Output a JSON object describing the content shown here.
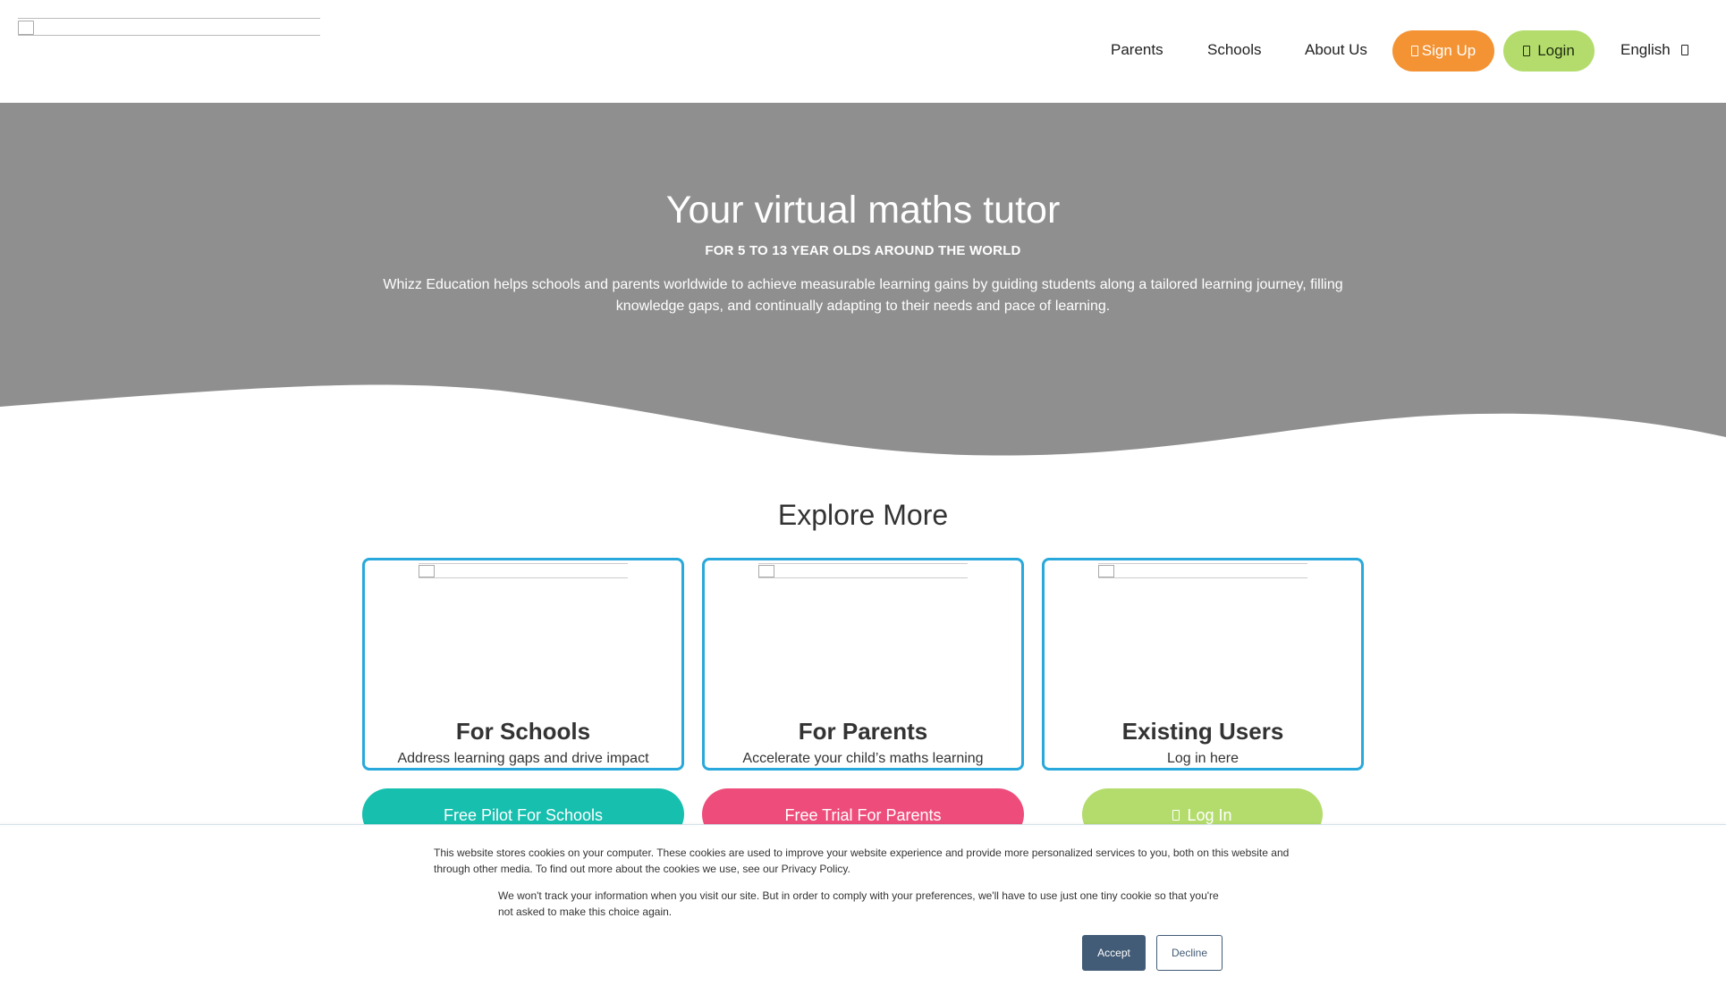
{
  "header": {
    "nav": [
      "Parents",
      "Schools",
      "About Us"
    ],
    "signup_label": "Sign Up",
    "login_label": "Login",
    "language": "English"
  },
  "hero": {
    "title": "Your virtual maths tutor",
    "subtitle": "FOR 5 TO 13 YEAR OLDS AROUND THE WORLD",
    "description": "Whizz Education helps schools and parents worldwide to achieve measurable learning gains by guiding students along a tailored learning journey, filling knowledge gaps, and continually adapting to their needs and pace of learning."
  },
  "explore": {
    "title": "Explore More",
    "cards": [
      {
        "title": "For Schools",
        "desc": "Address learning gaps and drive impact",
        "cta": "Free Pilot For Schools"
      },
      {
        "title": "For Parents",
        "desc": "Accelerate your child’s maths learning",
        "cta": "Free Trial For Parents"
      },
      {
        "title": "Existing Users",
        "desc": "Log in here",
        "cta": "Log In"
      }
    ]
  },
  "cookie": {
    "p1": "This website stores cookies on your computer. These cookies are used to improve your website experience and provide more personalized services to you, both on this website and through other media. To find out more about the cookies we use, see our Privacy Policy.",
    "p2": "We won't track your information when you visit our site. But in order to comply with your preferences, we'll have to use just one tiny cookie so that you're not asked to make this choice again.",
    "accept": "Accept",
    "decline": "Decline"
  },
  "colors": {
    "hero_bg": "#8f8f8f",
    "signup": "#f39334",
    "login": "#b3dc6c",
    "card_border": "#29a8db",
    "cta_schools": "#16bfae",
    "cta_parents": "#ee4d7b",
    "cta_login": "#b3dc6c",
    "cookie_button": "#425b76"
  }
}
